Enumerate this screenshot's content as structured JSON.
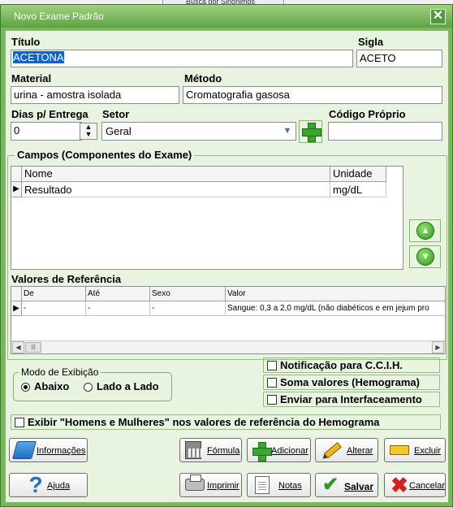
{
  "background": {
    "behind_tab_label": "Busca por Sinônimos"
  },
  "window": {
    "title": "Novo Exame Padrão",
    "close_glyph": "✕"
  },
  "form": {
    "titulo_label": "Título",
    "titulo_value": "ACETONA",
    "sigla_label": "Sigla",
    "sigla_value": "ACETO",
    "material_label": "Material",
    "material_value": "urina - amostra isolada",
    "metodo_label": "Método",
    "metodo_value": "Cromatografia gasosa",
    "dias_label": "Dias p/ Entrega",
    "dias_value": "0",
    "setor_label": "Setor",
    "setor_value": "Geral",
    "codigo_label": "Código Próprio",
    "codigo_value": ""
  },
  "campos": {
    "group_title": "Campos (Componentes do Exame)",
    "columns": [
      "Nome",
      "Unidade"
    ],
    "rows": [
      {
        "nome": "Resultado",
        "unidade": "mg/dL"
      }
    ]
  },
  "referencia": {
    "title": "Valores de Referência",
    "columns": [
      "De",
      "Até",
      "Sexo",
      "Valor"
    ],
    "rows": [
      {
        "de": "-",
        "ate": "-",
        "sexo": "-",
        "valor": "Sangue: 0,3 a 2,0 mg/dL (não diabéticos e em jejum pro"
      }
    ]
  },
  "modo": {
    "title": "Modo de Exibição",
    "options": [
      {
        "label": "Abaixo",
        "selected": true
      },
      {
        "label": "Lado a Lado",
        "selected": false
      }
    ]
  },
  "checks": {
    "notificacao": {
      "label": "Notificação para C.C.I.H.",
      "checked": false
    },
    "soma": {
      "label": "Soma valores (Hemograma)",
      "checked": false
    },
    "interfaceamento": {
      "label": "Enviar para Interfaceamento",
      "checked": false
    },
    "homens_mulheres": {
      "label": "Exibir \"Homens e Mulheres\" nos valores de referência do Hemograma",
      "checked": false
    }
  },
  "buttons": {
    "informacoes": "Informações",
    "formula": "Fórmula",
    "adicionar": "Adicionar",
    "alterar": "Alterar",
    "excluir": "Excluir",
    "ajuda": "Ajuda",
    "imprimir": "Imprimir",
    "notas": "Notas",
    "salvar": "Salvar",
    "cancelar": "Cancelar"
  },
  "colors": {
    "window_green": "#78b85d",
    "client_bg": "#e9f4e0",
    "selection_blue": "#0a64d8"
  }
}
